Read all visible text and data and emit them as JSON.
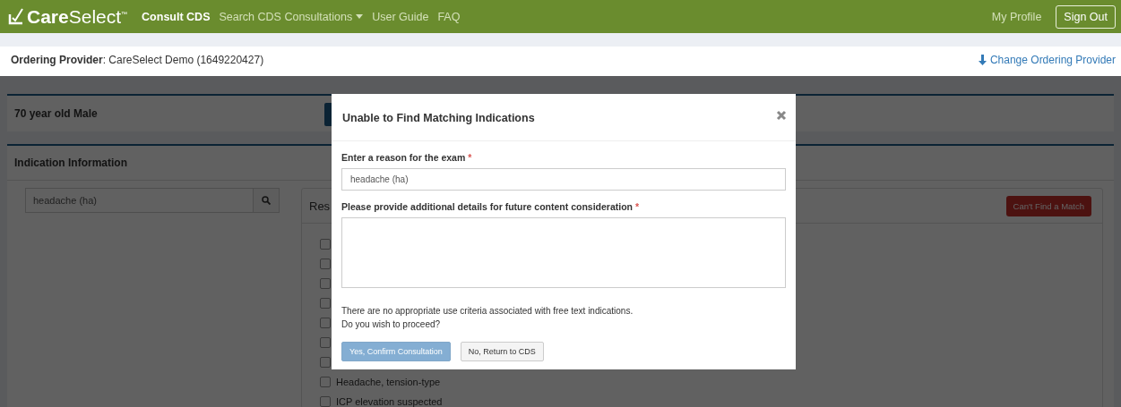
{
  "navbar": {
    "logo": "**Care**Select$^{™}$",
    "links": [
      {
        "label": "Consult CDS",
        "selected": true,
        "has_menu": false
      },
      {
        "label": "Search CDS Consultations",
        "selected": false,
        "has_menu": true
      },
      {
        "label": "User Guide",
        "selected": false,
        "has_menu": false
      },
      {
        "label": "FAQ",
        "selected": false,
        "has_menu": false
      }
    ],
    "profile_link": "My Profile",
    "sign_out": "Sign Out"
  },
  "provider_bar": {
    "text": "**Ordering Provider**: CareSelect Demo (1649220427)",
    "change_link": "Change Ordering Provider"
  },
  "background": {
    "patient": "70 year old Male",
    "indication_title": "Indication Information",
    "search_value": "headache (ha)",
    "results_title": "Res",
    "cant_find_button": "Can't Find a Match",
    "results": [
      {
        "checked": false
      },
      {
        "checked": false
      },
      {
        "checked": false
      },
      {
        "checked": false
      },
      {
        "checked": false
      },
      {
        "checked": false
      },
      {
        "checked": false
      },
      {
        "label": "Headache, tension-type",
        "checked": false
      },
      {
        "label": "ICP elevation suspected",
        "checked": false
      }
    ]
  },
  "modal": {
    "title": "Unable to Find Matching Indications",
    "fields": [
      {
        "label": "Enter a reason for the exam",
        "required_mark": "*",
        "kind": "input",
        "value": "headache (ha)"
      },
      {
        "label": "Please provide additional details for future content consideration",
        "required_mark": "*",
        "kind": "textarea"
      }
    ],
    "message": [
      "There are no appropriate use criteria associated with free text indications.",
      "Do you wish to proceed?"
    ],
    "buttons": [
      {
        "label": "Yes, Confirm Consultation",
        "kind": "primary",
        "disabled": true
      },
      {
        "label": "No, Return to CDS",
        "kind": "default",
        "disabled": false
      }
    ]
  }
}
